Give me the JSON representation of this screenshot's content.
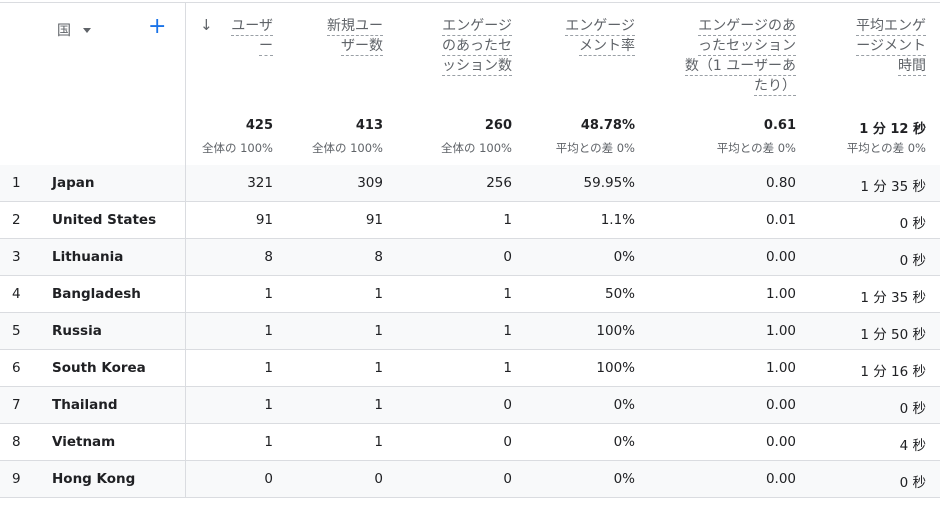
{
  "header": {
    "dimension_label": "国",
    "metrics": [
      {
        "label_lines": [
          "ユーザ",
          "ー"
        ]
      },
      {
        "label_lines": [
          "新規ユー",
          "ザー数"
        ]
      },
      {
        "label_lines": [
          "エンゲージ",
          "のあったセ",
          "ッション数"
        ]
      },
      {
        "label_lines": [
          "エンゲージ",
          "メント率"
        ]
      },
      {
        "label_lines": [
          "エンゲージのあ",
          "ったセッション",
          "数（1 ユーザーあ",
          "たり）"
        ]
      },
      {
        "label_lines": [
          "平均エンゲ",
          "ージメント",
          "時間"
        ]
      }
    ],
    "totals": [
      "425",
      "413",
      "260",
      "48.78%",
      "0.61",
      "1 分 12 秒"
    ],
    "subtotals": [
      "全体の 100%",
      "全体の 100%",
      "全体の 100%",
      "平均との差 0%",
      "平均との差 0%",
      "平均との差 0%"
    ]
  },
  "rows": [
    {
      "idx": "1",
      "country": "Japan",
      "vals": [
        "321",
        "309",
        "256",
        "59.95%",
        "0.80",
        "1 分 35 秒"
      ]
    },
    {
      "idx": "2",
      "country": "United States",
      "vals": [
        "91",
        "91",
        "1",
        "1.1%",
        "0.01",
        "0 秒"
      ]
    },
    {
      "idx": "3",
      "country": "Lithuania",
      "vals": [
        "8",
        "8",
        "0",
        "0%",
        "0.00",
        "0 秒"
      ]
    },
    {
      "idx": "4",
      "country": "Bangladesh",
      "vals": [
        "1",
        "1",
        "1",
        "50%",
        "1.00",
        "1 分 35 秒"
      ]
    },
    {
      "idx": "5",
      "country": "Russia",
      "vals": [
        "1",
        "1",
        "1",
        "100%",
        "1.00",
        "1 分 50 秒"
      ]
    },
    {
      "idx": "6",
      "country": "South Korea",
      "vals": [
        "1",
        "1",
        "1",
        "100%",
        "1.00",
        "1 分 16 秒"
      ]
    },
    {
      "idx": "7",
      "country": "Thailand",
      "vals": [
        "1",
        "1",
        "0",
        "0%",
        "0.00",
        "0 秒"
      ]
    },
    {
      "idx": "8",
      "country": "Vietnam",
      "vals": [
        "1",
        "1",
        "0",
        "0%",
        "0.00",
        "4 秒"
      ]
    },
    {
      "idx": "9",
      "country": "Hong Kong",
      "vals": [
        "0",
        "0",
        "0",
        "0%",
        "0.00",
        "0 秒"
      ]
    }
  ]
}
